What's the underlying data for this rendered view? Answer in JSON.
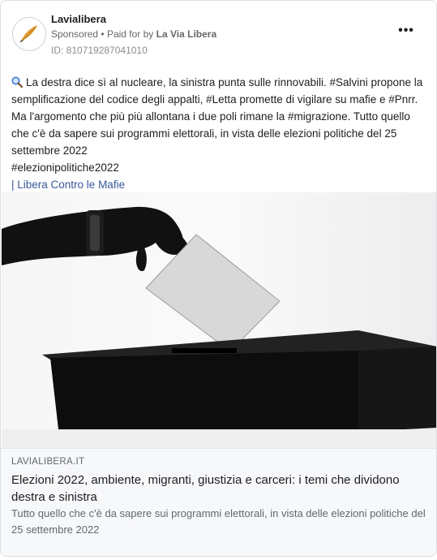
{
  "ad": {
    "page_name": "Lavialibera",
    "sponsored_label": "Sponsored",
    "separator": "•",
    "paid_for_prefix": "Paid for by",
    "paid_for_by": "La Via Libera",
    "ad_id": "ID: 810719287041010",
    "more_label": "•••"
  },
  "post": {
    "line1": "La destra dice sì al nucleare, la sinistra punta sulle rinnovabili. #Salvini propone la semplificazione del codice degli appalti, #Letta promette di vigilare su mafie e #Pnrr. Ma l'argomento che più più allontana i due poli rimane la #migrazione. Tutto quello che c'è da sapere sui programmi elettorali, in vista delle elezioni politiche del 25 settembre 2022",
    "hashtag": "#elezionipolitiche2022",
    "signature": "| Libera Contro le Mafie",
    "icon": "magnifying-glass"
  },
  "link_preview": {
    "domain": "LAVIALIBERA.IT",
    "headline": "Elezioni 2022, ambiente, migranti, giustizia e carceri: i temi che dividono destra e sinistra",
    "description": "Tutto quello che c'è da sapere sui programmi elettorali, in vista delle elezioni politiche del 25 settembre 2022"
  },
  "colors": {
    "link": "#385898",
    "secondary_text": "#65676b",
    "footer_bg": "#f7f8fa",
    "logo_gold": "#e8a33a"
  }
}
